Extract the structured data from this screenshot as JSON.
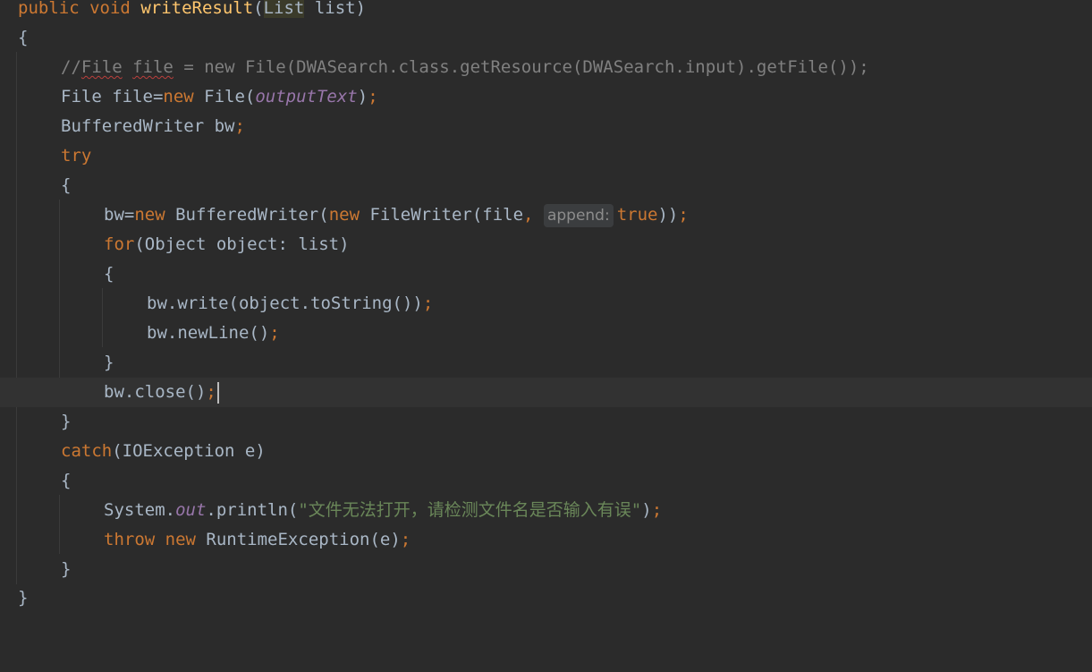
{
  "editor": {
    "lines": {
      "l1": {
        "kw1": "public",
        "kw2": "void",
        "method": "writeResult",
        "paren": "(",
        "type": "List",
        "rest": " list)"
      },
      "l2": {
        "text": "{"
      },
      "l3": {
        "slashes": "//",
        "w1": "File",
        "sp1": " ",
        "w2": "file",
        "rest": " = new File(DWASearch.class.getResource(DWASearch.input).getFile());"
      },
      "l4": {
        "pre": "File file=",
        "kw": "new",
        "mid": " File(",
        "field": "outputText",
        "post": ")",
        "semi": ";"
      },
      "l5": {
        "pre": "BufferedWriter bw",
        "semi": ";"
      },
      "l6": {
        "kw": "try"
      },
      "l7": {
        "text": "{"
      },
      "l8": {
        "pre": "bw=",
        "kw1": "new",
        "mid1": " BufferedWriter(",
        "kw2": "new",
        "mid2": " FileWriter(file",
        "comma": ",",
        "hint": "append:",
        "kw3": "true",
        "post": "))",
        "semi": ";"
      },
      "l9": {
        "kw": "for",
        "rest": "(Object object: list)"
      },
      "l10": {
        "text": "{"
      },
      "l11": {
        "pre": "bw.write(object.toString())",
        "semi": ";"
      },
      "l12": {
        "pre": "bw.newLine()",
        "semi": ";"
      },
      "l13": {
        "text": "}"
      },
      "l14": {
        "pre": "bw.close()",
        "semi": ";"
      },
      "l15": {
        "text": "}"
      },
      "l16": {
        "kw": "catch",
        "rest": "(IOException e)"
      },
      "l17": {
        "text": "{"
      },
      "l18": {
        "pre": "System.",
        "field": "out",
        "mid": ".println(",
        "str": "\"文件无法打开，请检测文件名是否输入有误\"",
        "post": ")",
        "semi": ";"
      },
      "l19": {
        "kw1": "throw",
        "kw2": "new",
        "rest": " RuntimeException(e)",
        "semi": ";"
      },
      "l20": {
        "text": "}"
      },
      "l21": {
        "text": "}"
      }
    }
  },
  "colors": {
    "background": "#2b2b2b",
    "keyword": "#cc7832",
    "method": "#ffc66d",
    "field": "#9876aa",
    "string": "#6a8759",
    "comment": "#808080",
    "text": "#a9b7c6"
  }
}
